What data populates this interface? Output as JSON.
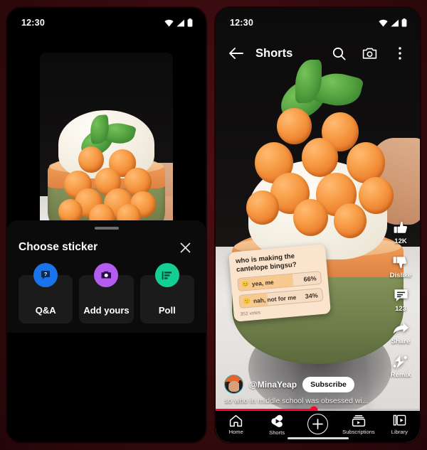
{
  "page": {
    "background_color": "#3a0c0f",
    "accent_red": "#ff0033"
  },
  "status_bar": {
    "time": "12:30",
    "icons": [
      "wifi-icon",
      "cellular-signal-icon",
      "battery-icon"
    ]
  },
  "left_phone": {
    "name": "shorts-editor-screen",
    "video_preview": {
      "description": "cantaloupe melon ball bingsu dessert on marble"
    },
    "sticker_sheet": {
      "title": "Choose sticker",
      "close_icon": "close-icon",
      "handle": "drag-handle",
      "options": [
        {
          "label": "Q&A",
          "icon": "question-bubble-icon",
          "color": "#1a73e8"
        },
        {
          "label": "Add yours",
          "icon": "camera-icon",
          "color": "#b45cf0"
        },
        {
          "label": "Poll",
          "icon": "poll-bars-icon",
          "color": "#14cf93"
        }
      ]
    }
  },
  "right_phone": {
    "name": "shorts-player-screen",
    "header": {
      "back_icon": "back-arrow-icon",
      "title": "Shorts",
      "actions": [
        "search-icon",
        "camera-icon",
        "more-vertical-icon"
      ]
    },
    "poll_sticker": {
      "question": "who is making the cantelope bingsu?",
      "options": [
        {
          "emoji": "😊",
          "label": "yea, me",
          "percent": "66%",
          "fill": 66
        },
        {
          "emoji": "🙂",
          "label": "nah, not for me",
          "percent": "34%",
          "fill": 34
        }
      ],
      "votes": "352 votes",
      "background_color": "#fbe4ce"
    },
    "action_rail": [
      {
        "icon": "thumbs-up-icon",
        "label": "12K"
      },
      {
        "icon": "thumbs-down-icon",
        "label": "Dislike"
      },
      {
        "icon": "comment-icon",
        "label": "123"
      },
      {
        "icon": "share-arrow-icon",
        "label": "Share"
      },
      {
        "icon": "remix-icon",
        "label": "Remix"
      }
    ],
    "channel": {
      "avatar": "channel-avatar",
      "handle": "@MinaYeap",
      "subscribe_label": "Subscribe"
    },
    "caption": "so who in middle school was obsessed wi...",
    "progress": {
      "percent": 48
    },
    "bottom_nav": [
      {
        "label": "Home",
        "icon": "home-icon"
      },
      {
        "label": "Shorts",
        "icon": "shorts-icon"
      },
      {
        "label": "",
        "icon": "plus-icon"
      },
      {
        "label": "Subscriptions",
        "icon": "subscriptions-icon"
      },
      {
        "label": "Library",
        "icon": "library-icon"
      }
    ]
  }
}
